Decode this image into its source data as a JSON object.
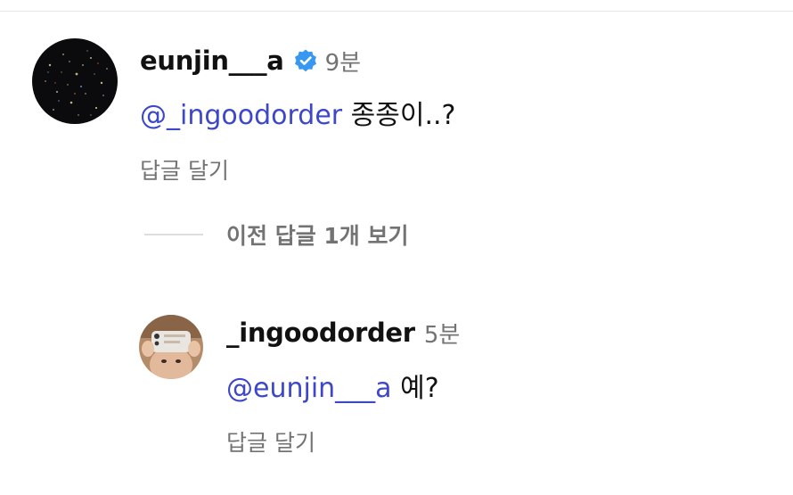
{
  "comment": {
    "username": "eunjin___a",
    "verified": true,
    "time": "9분",
    "mention": "@_ingoodorder",
    "text": " 종종이..?",
    "reply_label": "답글 달기"
  },
  "view_previous": {
    "label": "이전 답글 1개 보기"
  },
  "reply": {
    "username": "_ingoodorder",
    "time": "5분",
    "mention": "@eunjin___a",
    "text": " 예?",
    "reply_label": "답글 달기"
  },
  "colors": {
    "mention": "#3d47c9",
    "meta_gray": "#737373",
    "verified_blue": "#3897f0"
  },
  "icons": {
    "verified": "verified-badge-icon"
  }
}
